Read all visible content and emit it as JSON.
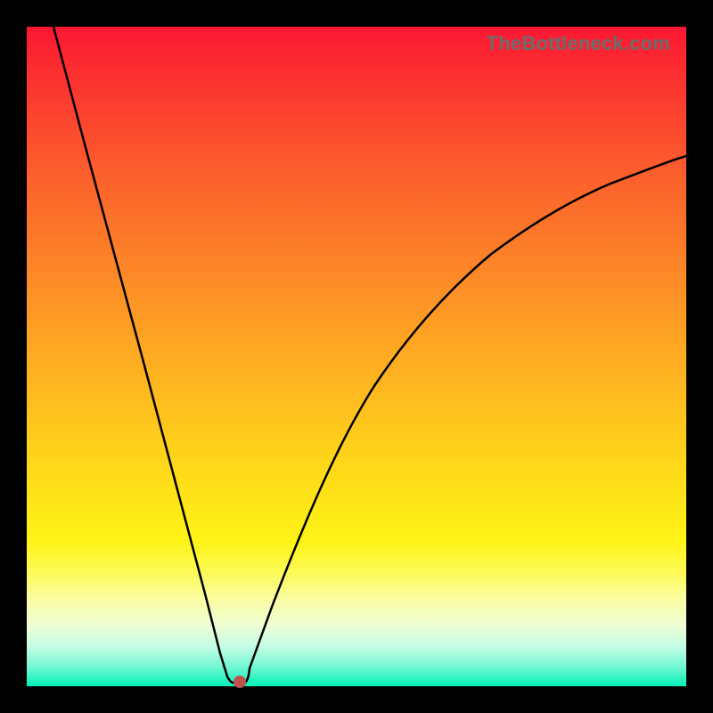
{
  "watermark": {
    "text": "TheBottleneck.com"
  },
  "chart_data": {
    "type": "line",
    "title": "",
    "xlabel": "",
    "ylabel": "",
    "xlim": [
      0,
      1
    ],
    "ylim": [
      0,
      1
    ],
    "series": [
      {
        "name": "bottleneck-curve",
        "x": [
          0.0,
          0.05,
          0.1,
          0.15,
          0.2,
          0.25,
          0.275,
          0.29,
          0.3,
          0.31,
          0.325,
          0.35,
          0.4,
          0.45,
          0.5,
          0.55,
          0.6,
          0.65,
          0.7,
          0.75,
          0.8,
          0.85,
          0.9,
          0.95,
          1.0
        ],
        "y": [
          1.0,
          0.83,
          0.66,
          0.49,
          0.315,
          0.14,
          0.05,
          0.01,
          0.0,
          0.0,
          0.03,
          0.12,
          0.26,
          0.37,
          0.455,
          0.525,
          0.585,
          0.635,
          0.675,
          0.71,
          0.74,
          0.765,
          0.785,
          0.805,
          0.82
        ]
      }
    ],
    "annotations": [
      {
        "name": "min-marker",
        "x": 0.305,
        "y": 0.0,
        "color": "#c2504d"
      }
    ],
    "gradient_stops": [
      {
        "pos": 0.0,
        "color": "#fb1732"
      },
      {
        "pos": 0.5,
        "color": "#fda822"
      },
      {
        "pos": 0.8,
        "color": "#fef51a"
      },
      {
        "pos": 1.0,
        "color": "#03f1b9"
      }
    ]
  }
}
